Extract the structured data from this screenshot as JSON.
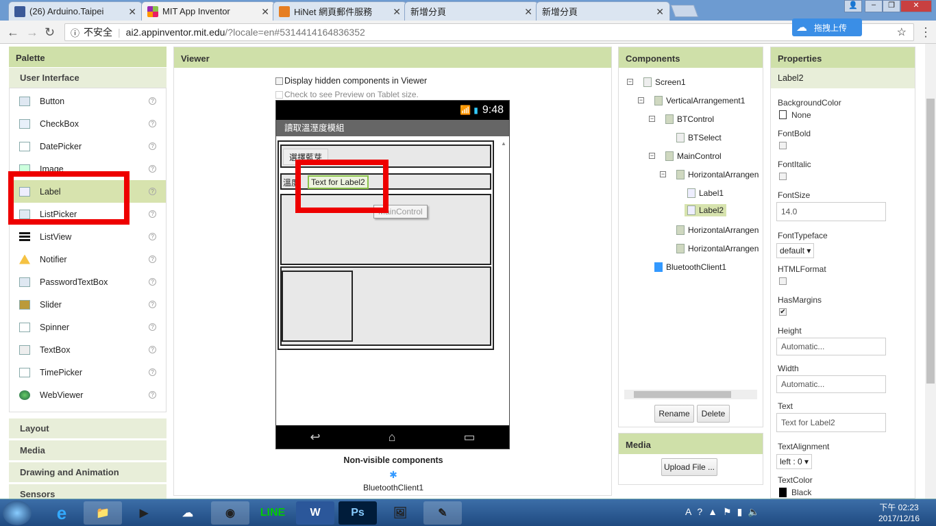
{
  "browser": {
    "tabs": [
      {
        "title": "(26) Arduino.Taipei",
        "icon": "facebook-icon",
        "color": "#3b5998"
      },
      {
        "title": "MIT App Inventor",
        "icon": "app-inventor-icon",
        "color": "#8bc34a"
      },
      {
        "title": "HiNet 網頁郵件服務",
        "icon": "mail-icon",
        "color": "#e67e22"
      },
      {
        "title": "新增分頁",
        "icon": "",
        "color": ""
      },
      {
        "title": "新增分頁",
        "icon": "",
        "color": ""
      }
    ],
    "insecure_label": "不安全",
    "url_host": "ai2.appinventor.mit.edu",
    "url_rest": "/?locale=en#5314414164836352",
    "upload_button": "拖拽上传"
  },
  "palette": {
    "title": "Palette",
    "categories": [
      "User Interface",
      "Layout",
      "Media",
      "Drawing and Animation",
      "Sensors"
    ],
    "items": [
      {
        "label": "Button",
        "icon": "button-icon"
      },
      {
        "label": "CheckBox",
        "icon": "checkbox-icon"
      },
      {
        "label": "DatePicker",
        "icon": "datepicker-icon"
      },
      {
        "label": "Image",
        "icon": "image-icon"
      },
      {
        "label": "Label",
        "icon": "label-icon"
      },
      {
        "label": "ListPicker",
        "icon": "listpicker-icon"
      },
      {
        "label": "ListView",
        "icon": "listview-icon"
      },
      {
        "label": "Notifier",
        "icon": "notifier-icon"
      },
      {
        "label": "PasswordTextBox",
        "icon": "password-icon"
      },
      {
        "label": "Slider",
        "icon": "slider-icon"
      },
      {
        "label": "Spinner",
        "icon": "spinner-icon"
      },
      {
        "label": "TextBox",
        "icon": "textbox-icon"
      },
      {
        "label": "TimePicker",
        "icon": "timepicker-icon"
      },
      {
        "label": "WebViewer",
        "icon": "webviewer-icon"
      }
    ],
    "help_glyph": "?"
  },
  "viewer": {
    "title": "Viewer",
    "hidden_checkbox": "Display hidden components in Viewer",
    "tablet_checkbox": "Check to see Preview on Tablet size.",
    "phone_time": "9:48",
    "app_title": "讀取溫溼度模組",
    "button_text": "選擇藍芽",
    "temp_label": "溫度",
    "label2_text": "Text for Label2",
    "drag_tooltip": "MainControl",
    "nonvisible_title": "Non-visible components",
    "nonvisible_item": "BluetoothClient1"
  },
  "components": {
    "title": "Components",
    "tree": [
      "Screen1",
      "VerticalArrangement1",
      "BTControl",
      "BTSelect",
      "MainControl",
      "HorizontalArrangen",
      "Label1",
      "Label2",
      "HorizontalArrangen",
      "HorizontalArrangen",
      "BluetoothClient1"
    ],
    "rename": "Rename",
    "delete": "Delete"
  },
  "media": {
    "title": "Media",
    "upload": "Upload File ..."
  },
  "properties": {
    "title": "Properties",
    "component": "Label2",
    "bgcolor_label": "BackgroundColor",
    "bgcolor_value": "None",
    "fontbold_label": "FontBold",
    "fontitalic_label": "FontItalic",
    "fontsize_label": "FontSize",
    "fontsize_value": "14.0",
    "typeface_label": "FontTypeface",
    "typeface_value": "default ▾",
    "html_label": "HTMLFormat",
    "margins_label": "HasMargins",
    "margins_check": "✔",
    "height_label": "Height",
    "height_value": "Automatic...",
    "width_label": "Width",
    "width_value": "Automatic...",
    "text_label": "Text",
    "text_value": "Text for Label2",
    "align_label": "TextAlignment",
    "align_value": "left : 0 ▾",
    "textcolor_label": "TextColor",
    "textcolor_value": "Black"
  },
  "taskbar": {
    "time": "下午 02:23",
    "date": "2017/12/16",
    "start": "start-orb-icon",
    "ime": "A"
  }
}
